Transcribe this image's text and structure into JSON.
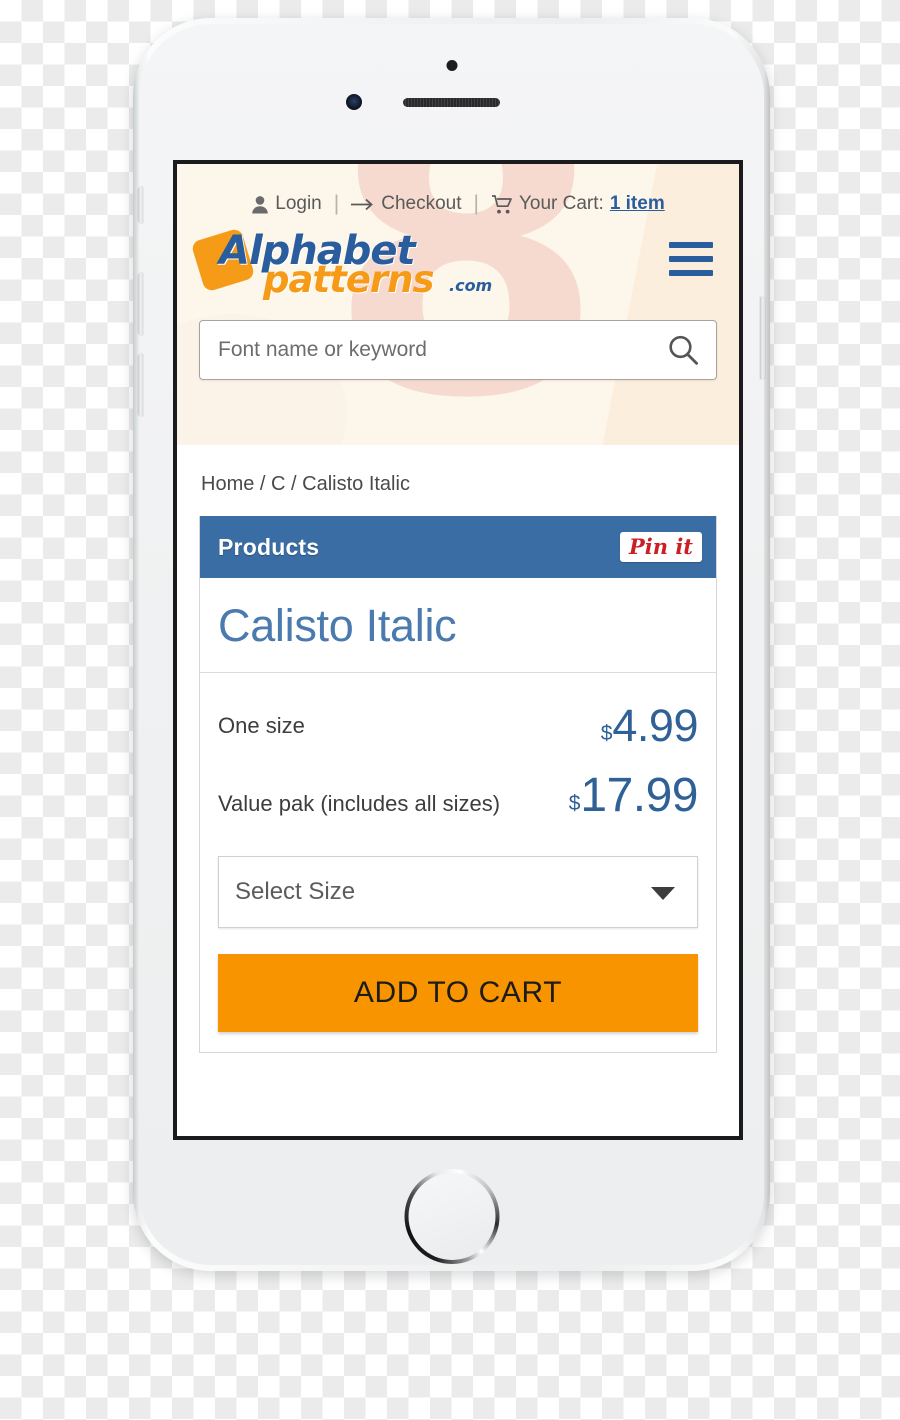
{
  "device": {
    "name": "white-smartphone-mockup",
    "sensor_icon": "proximity-sensor",
    "camera_icon": "front-camera",
    "speaker_icon": "earpiece-speaker",
    "home_button_icon": "home-button"
  },
  "topnav": {
    "login_icon": "user-icon",
    "login_label": "Login",
    "separator": "|",
    "checkout_icon": "arrow-right-icon",
    "checkout_label": "Checkout",
    "cart_icon": "shopping-cart-icon",
    "cart_label": "Your Cart:",
    "cart_count": "1 item"
  },
  "logo": {
    "word1": "Alphabet",
    "word2": "patterns",
    "tld": ".com",
    "badge_color": "#f59b17",
    "blue": "#2a5d9e"
  },
  "menu": {
    "icon": "hamburger-menu-icon"
  },
  "search": {
    "placeholder": "Font name or keyword",
    "value": "",
    "icon": "search-icon"
  },
  "breadcrumb": {
    "text": "Home / C / Calisto Italic"
  },
  "card": {
    "header_title": "Products",
    "pinit_label": "Pin it",
    "pinit_color": "#cb1f27",
    "header_color": "#3a6da3",
    "product_title": "Calisto Italic",
    "title_color": "#4a7aae"
  },
  "prices": [
    {
      "label": "One size",
      "currency": "$",
      "amount": "4.99"
    },
    {
      "label": "Value pak (includes all sizes)",
      "currency": "$",
      "amount": "17.99"
    }
  ],
  "size_select": {
    "selected": "Select Size",
    "caret_icon": "chevron-down-icon"
  },
  "cta": {
    "label": "ADD TO CART",
    "color": "#f79400"
  }
}
